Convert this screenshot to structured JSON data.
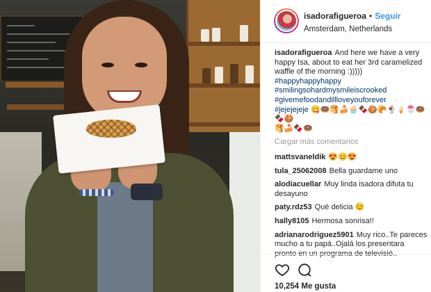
{
  "post": {
    "username": "isadorafigueroa",
    "separator": "•",
    "follow_label": "Seguir",
    "location": "Amsterdam, Netherlands",
    "caption": {
      "username": "isadorafigueroa",
      "text": "And here we have a very happy Isa, about to eat her 3rd caramelized waffle of the morning :)))))",
      "hashtags": [
        "#happyhappyhappy",
        "#smilingsohardmysmileiscrooked",
        "#givemefoodandillloveyouforever",
        "#jejejejeje 😋🍩🥞🍰🧁🍫🍪🥐🍨🍦🍧🍩🍫🍪"
      ],
      "emoji_tail": "🥞🍰🍫🍩"
    },
    "load_more_label": "Cargar más comentarios",
    "comments": [
      {
        "user": "mattsvaneldik",
        "text": "😍😊😍"
      },
      {
        "user": "tula_25062008",
        "text": "Bella guardame uno"
      },
      {
        "user": "alodiacuellar",
        "text": "Muy linda isadora difuta tu desayuno"
      },
      {
        "user": "paty.rdz53",
        "text": "Qué delicia 😊"
      },
      {
        "user": "hally8105",
        "text": "Hermosa sonrisa!!"
      },
      {
        "user": "adrianarodriguez5901",
        "text": "Muy rico..Te pareces mucho a tu papá..Ojalá los presentara pronto en un programa de televisió.."
      }
    ],
    "likes": "10,254 Me gusta",
    "icons": {
      "like": "heart-icon",
      "comment": "comment-icon"
    }
  },
  "colors": {
    "link_blue": "#3897f0",
    "hashtag_blue": "#003569",
    "muted": "#999999"
  }
}
